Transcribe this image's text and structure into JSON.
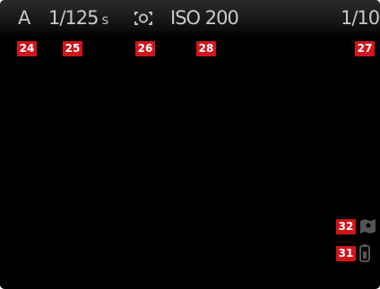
{
  "topbar": {
    "mode": "A",
    "shutter_value": "1/125",
    "shutter_unit": "s",
    "metering_icon": "center-weighted-metering-icon",
    "iso": "ISO 200",
    "frame_counter": "1/10"
  },
  "callouts": {
    "mode": "24",
    "shutter": "25",
    "metering": "26",
    "iso": "28",
    "frame_counter": "27",
    "gps": "32",
    "battery": "31"
  },
  "status_icons": {
    "gps": "gps-icon",
    "battery": "battery-icon"
  },
  "colors": {
    "screen_background": "#000000",
    "overlay_text": "#c9c9c9",
    "callout_badge": "#d2151c",
    "callout_text": "#ffffff"
  }
}
